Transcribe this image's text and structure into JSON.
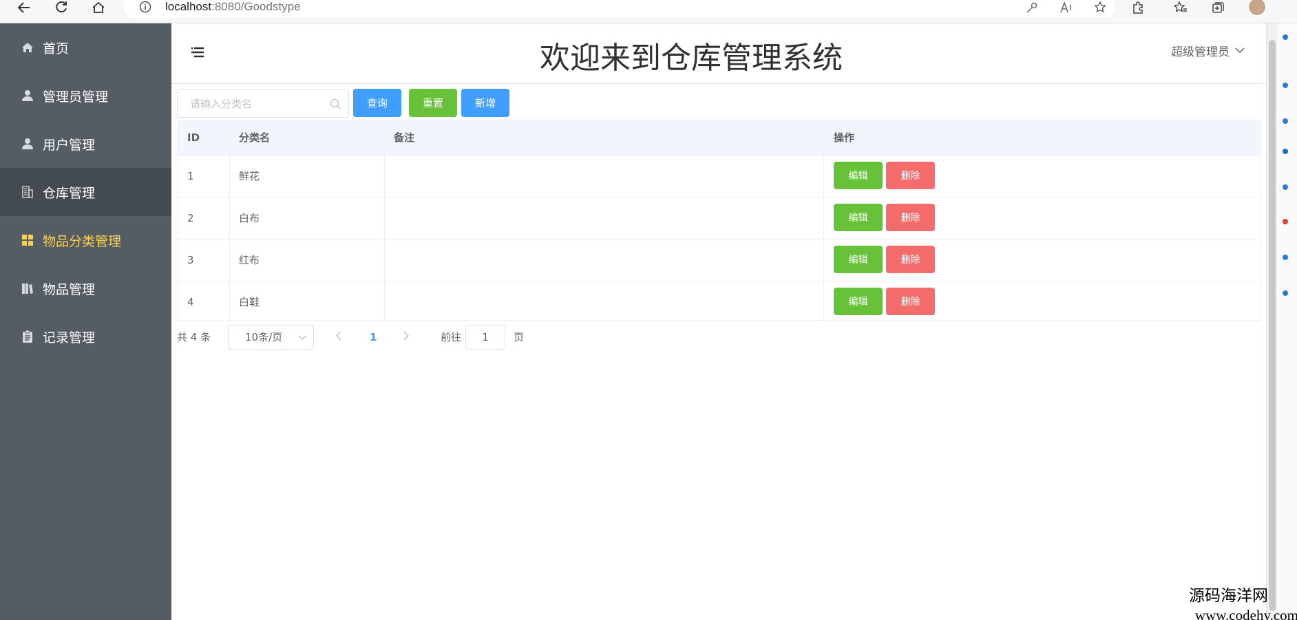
{
  "browser": {
    "url_host": "localhost",
    "url_path": ":8080/Goodstype"
  },
  "sidebar": {
    "items": [
      {
        "label": "首页",
        "icon": "home-icon"
      },
      {
        "label": "管理员管理",
        "icon": "person-icon"
      },
      {
        "label": "用户管理",
        "icon": "person-icon"
      },
      {
        "label": "仓库管理",
        "icon": "building-icon"
      },
      {
        "label": "物品分类管理",
        "icon": "grid-icon",
        "active": true
      },
      {
        "label": "物品管理",
        "icon": "books-icon"
      },
      {
        "label": "记录管理",
        "icon": "clipboard-icon"
      }
    ]
  },
  "header": {
    "title": "欢迎来到仓库管理系统",
    "user": "超级管理员"
  },
  "toolbar": {
    "search_placeholder": "请输入分类名",
    "query_label": "查询",
    "reset_label": "重置",
    "add_label": "新增"
  },
  "table": {
    "headers": [
      "ID",
      "分类名",
      "备注",
      "操作"
    ],
    "rows": [
      {
        "id": "1",
        "name": "鲜花",
        "remark": ""
      },
      {
        "id": "2",
        "name": "白布",
        "remark": ""
      },
      {
        "id": "3",
        "name": "红布",
        "remark": ""
      },
      {
        "id": "4",
        "name": "白鞋",
        "remark": ""
      }
    ],
    "edit_label": "编辑",
    "delete_label": "删除"
  },
  "pagination": {
    "total": "共 4 条",
    "page_size": "10条/页",
    "current": "1",
    "goto_label": "前往",
    "goto_value": "1",
    "page_label": "页"
  },
  "watermark": {
    "line1": "源码海洋网",
    "line2": "www.codehy.com"
  },
  "colors": {
    "sidebar_bg": "#545c64",
    "active": "#ffd04b",
    "primary": "#409eff",
    "success": "#67c23a",
    "danger": "#f56c6c"
  }
}
